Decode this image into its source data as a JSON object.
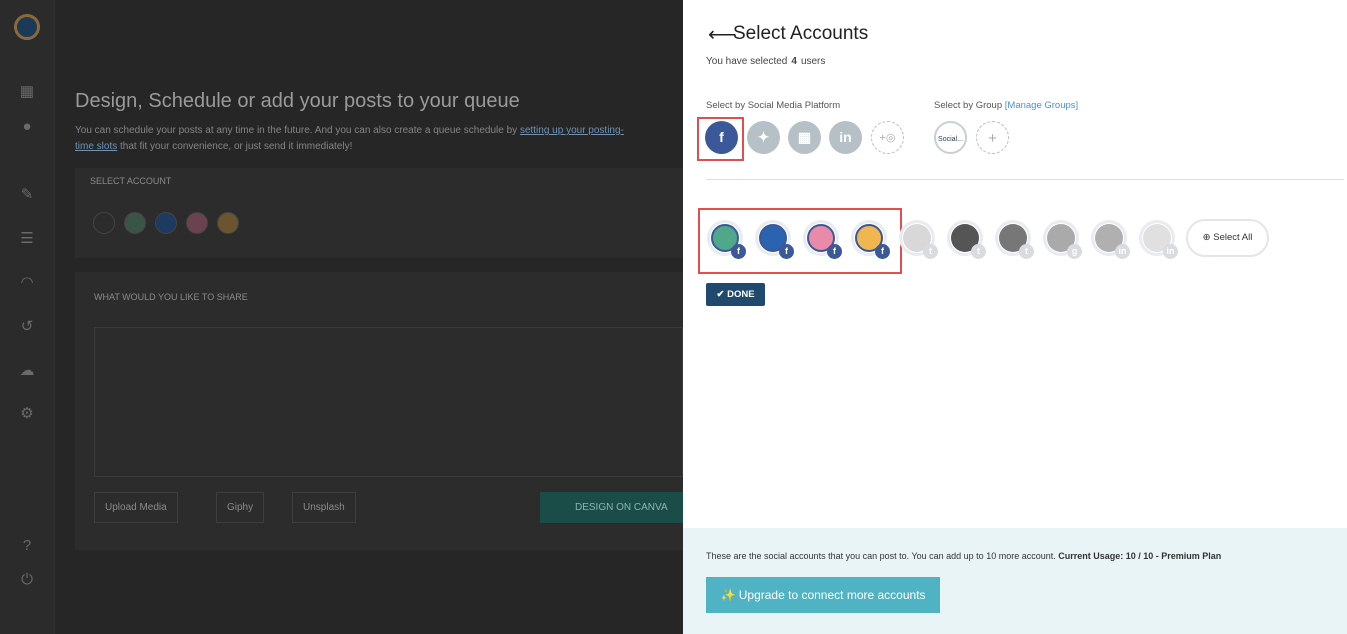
{
  "background": {
    "title": "Design, Schedule or add your posts to your queue",
    "description": "You can schedule your posts at any time in the future. And you can also create a queue schedule by",
    "description_link": "setting up your posting-time slots",
    "description_end": "that fit your convenience, or just send it immediately!",
    "select_account": "SELECT ACCOUNT",
    "mini_count": "4",
    "share_label": "WHAT WOULD YOU LIKE TO SHARE",
    "upload_media": "Upload Media",
    "giphy": "Giphy",
    "unsplash": "Unsplash",
    "canva": "DESIGN ON CANVA"
  },
  "panel": {
    "title": "Select Accounts",
    "selected_prefix": "You have selected",
    "selected_count": "4",
    "selected_suffix": "users",
    "platform_label": "Select by Social Media Platform",
    "group_label": "Select by Group",
    "manage_groups": "[Manage Groups]",
    "platforms": [
      {
        "name": "facebook",
        "glyph": "f",
        "selected": true
      },
      {
        "name": "twitter",
        "glyph": "🐦",
        "selected": false
      },
      {
        "name": "google-my-business",
        "glyph": "▦",
        "selected": false
      },
      {
        "name": "linkedin",
        "glyph": "in",
        "selected": false
      },
      {
        "name": "add-instagram",
        "glyph": "+◎",
        "selected": false
      }
    ],
    "group": "Social...",
    "add_group": "+",
    "accounts": [
      {
        "platform": "facebook",
        "selected": true,
        "color": "#4fa88a",
        "badge": "f"
      },
      {
        "platform": "facebook",
        "selected": true,
        "color": "#2a64b0",
        "badge": "f"
      },
      {
        "platform": "facebook",
        "selected": true,
        "color": "#e98aa8",
        "badge": "f"
      },
      {
        "platform": "facebook",
        "selected": true,
        "color": "#f0b650",
        "badge": "f"
      },
      {
        "platform": "twitter",
        "selected": false,
        "color": "#d8d8d8",
        "badge": "t"
      },
      {
        "platform": "twitter",
        "selected": false,
        "color": "#555555",
        "badge": "t"
      },
      {
        "platform": "twitter",
        "selected": false,
        "color": "#777777",
        "badge": "t"
      },
      {
        "platform": "google-my-business",
        "selected": false,
        "color": "#aaaaaa",
        "badge": "g"
      },
      {
        "platform": "linkedin",
        "selected": false,
        "color": "#b0b0b0",
        "badge": "in"
      },
      {
        "platform": "linkedin",
        "selected": false,
        "color": "#e0e0e0",
        "badge": "in"
      }
    ],
    "select_all": "Select All",
    "done": "DONE",
    "footer_text": "These are the social accounts that you can post to. You can add up to 10 more account.",
    "footer_usage": "Current Usage: 10 / 10 - Premium Plan",
    "upgrade": "Upgrade to connect more accounts"
  }
}
